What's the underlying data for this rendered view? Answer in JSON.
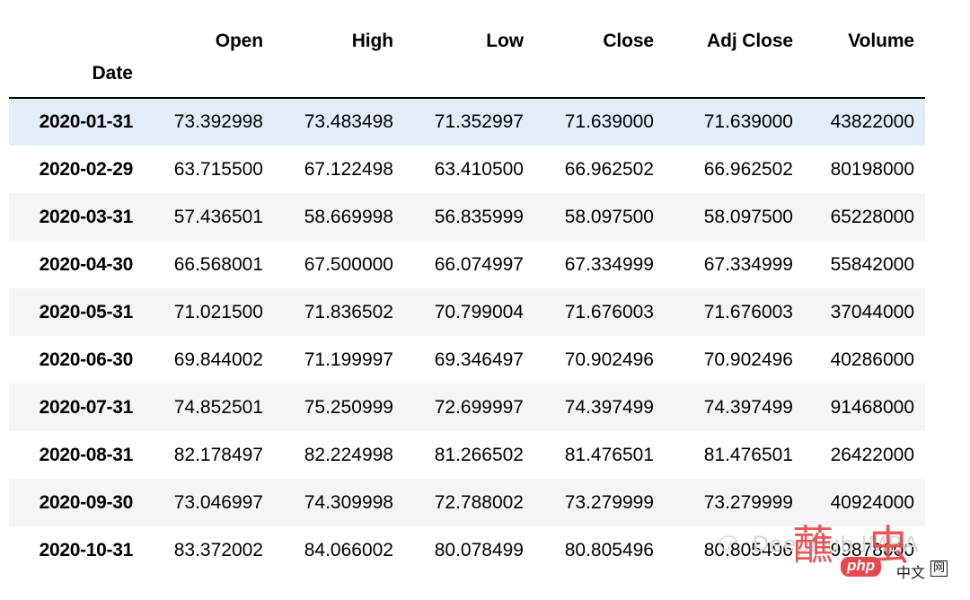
{
  "table": {
    "index_name": "Date",
    "columns": [
      "Open",
      "High",
      "Low",
      "Close",
      "Adj Close",
      "Volume"
    ],
    "rows": [
      {
        "date": "2020-01-31",
        "open": "73.392998",
        "high": "73.483498",
        "low": "71.352997",
        "close": "71.639000",
        "adj_close": "71.639000",
        "volume": "43822000",
        "style": "highlight"
      },
      {
        "date": "2020-02-29",
        "open": "63.715500",
        "high": "67.122498",
        "low": "63.410500",
        "close": "66.962502",
        "adj_close": "66.962502",
        "volume": "80198000",
        "style": "white"
      },
      {
        "date": "2020-03-31",
        "open": "57.436501",
        "high": "58.669998",
        "low": "56.835999",
        "close": "58.097500",
        "adj_close": "58.097500",
        "volume": "65228000",
        "style": "gray"
      },
      {
        "date": "2020-04-30",
        "open": "66.568001",
        "high": "67.500000",
        "low": "66.074997",
        "close": "67.334999",
        "adj_close": "67.334999",
        "volume": "55842000",
        "style": "white"
      },
      {
        "date": "2020-05-31",
        "open": "71.021500",
        "high": "71.836502",
        "low": "70.799004",
        "close": "71.676003",
        "adj_close": "71.676003",
        "volume": "37044000",
        "style": "gray"
      },
      {
        "date": "2020-06-30",
        "open": "69.844002",
        "high": "71.199997",
        "low": "69.346497",
        "close": "70.902496",
        "adj_close": "70.902496",
        "volume": "40286000",
        "style": "white"
      },
      {
        "date": "2020-07-31",
        "open": "74.852501",
        "high": "75.250999",
        "low": "72.699997",
        "close": "74.397499",
        "adj_close": "74.397499",
        "volume": "91468000",
        "style": "gray"
      },
      {
        "date": "2020-08-31",
        "open": "82.178497",
        "high": "82.224998",
        "low": "81.266502",
        "close": "81.476501",
        "adj_close": "81.476501",
        "volume": "26422000",
        "style": "white"
      },
      {
        "date": "2020-09-30",
        "open": "73.046997",
        "high": "74.309998",
        "low": "72.788002",
        "close": "73.279999",
        "adj_close": "73.279999",
        "volume": "40924000",
        "style": "gray"
      },
      {
        "date": "2020-10-31",
        "open": "83.372002",
        "high": "84.066002",
        "low": "80.078499",
        "close": "80.805496",
        "adj_close": "80.805496",
        "volume": "99878000",
        "style": "white"
      }
    ]
  },
  "watermarks": {
    "deephub": "DeepHub IMBA",
    "php_left_char": "蘸",
    "php_right_char": "虫",
    "php_tag": "php",
    "php_small": "中文",
    "php_box": "网"
  },
  "colors": {
    "highlight_row": "#e2edf8",
    "stripe_row": "#f5f5f5",
    "rule": "#000000",
    "text": "#000000",
    "watermark_gray": "#d7d7d7",
    "watermark_red": "#e8484c"
  }
}
